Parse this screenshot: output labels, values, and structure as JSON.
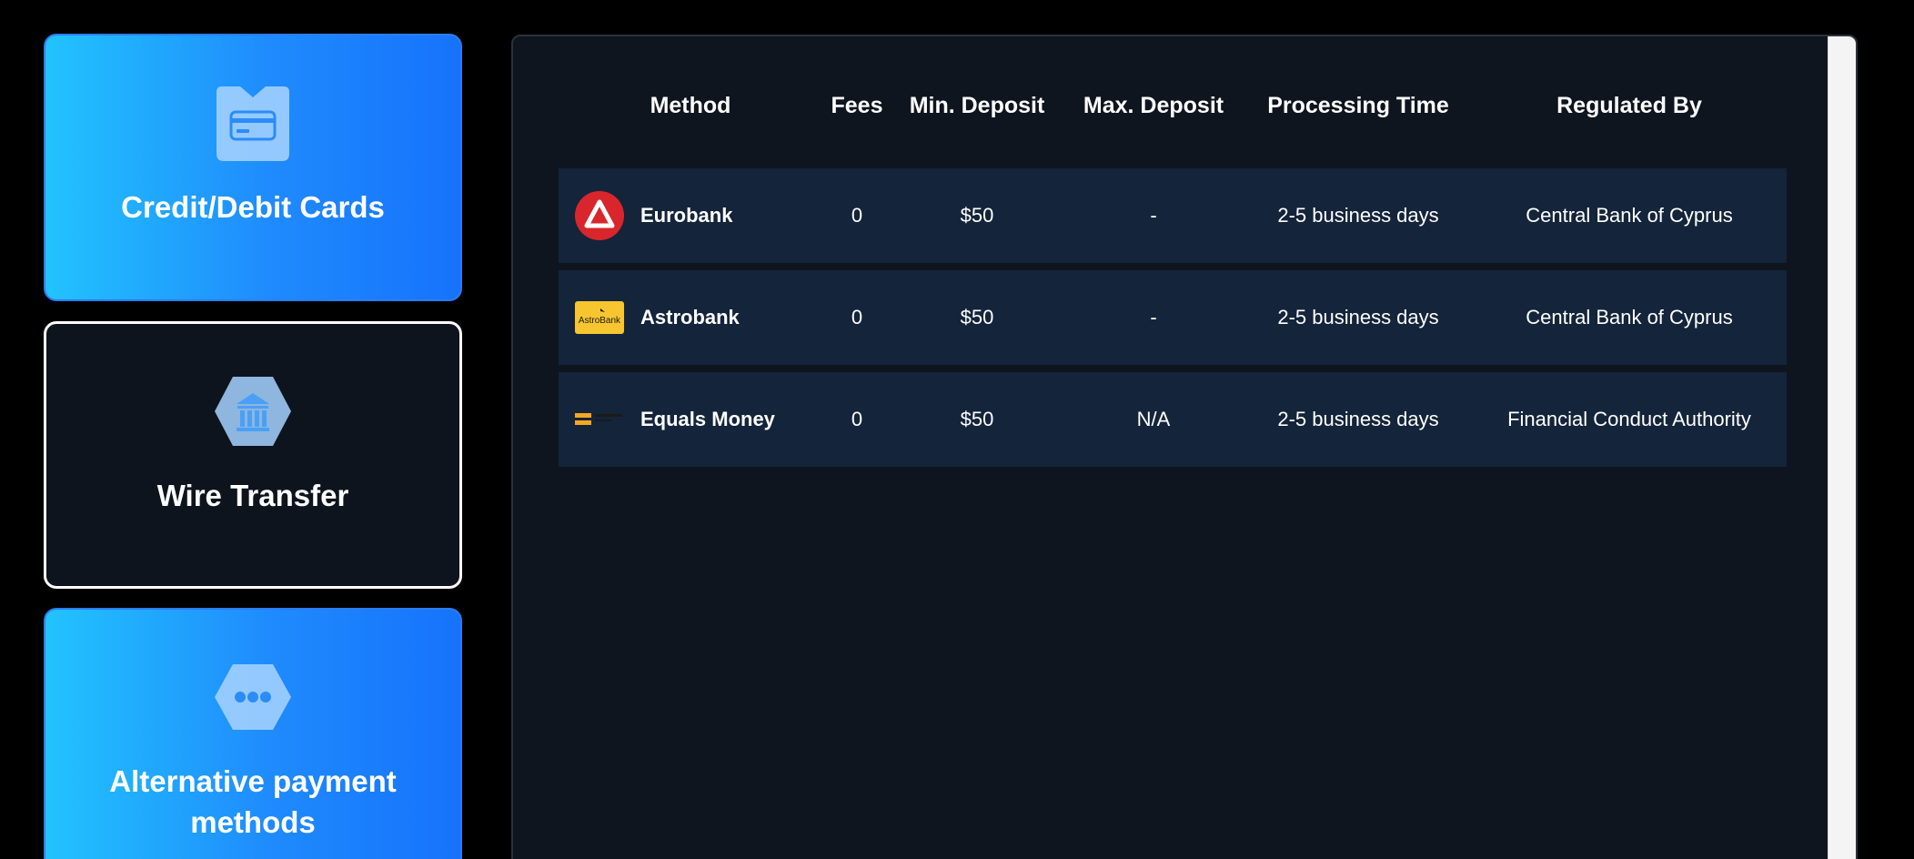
{
  "categories": [
    {
      "label": "Credit/Debit Cards",
      "icon": "credit-card-icon",
      "active": true
    },
    {
      "label": "Wire Transfer",
      "icon": "bank-icon",
      "active": false
    },
    {
      "label": "Alternative payment methods",
      "icon": "more-dots-icon",
      "active": true
    }
  ],
  "table": {
    "headers": {
      "method": "Method",
      "fees": "Fees",
      "min_deposit": "Min. Deposit",
      "max_deposit": "Max. Deposit",
      "processing_time": "Processing Time",
      "regulated_by": "Regulated By"
    },
    "rows": [
      {
        "name": "Eurobank",
        "logo": "eurobank-logo",
        "fees": "0",
        "min_deposit": "$50",
        "max_deposit": "-",
        "processing_time": "2-5 business days",
        "regulated_by": "Central Bank of Cyprus"
      },
      {
        "name": "Astrobank",
        "logo": "astrobank-logo",
        "logo_text": "AstroBank",
        "fees": "0",
        "min_deposit": "$50",
        "max_deposit": "-",
        "processing_time": "2-5 business days",
        "regulated_by": "Central Bank of Cyprus"
      },
      {
        "name": "Equals Money",
        "logo": "equals-money-logo",
        "fees": "0",
        "min_deposit": "$50",
        "max_deposit": "N/A",
        "processing_time": "2-5 business days",
        "regulated_by": "Financial Conduct Authority"
      }
    ]
  },
  "colors": {
    "accent_gradient_start": "#22c3fd",
    "accent_gradient_end": "#1673fb",
    "panel_background": "#0e151f",
    "row_background": "#14243a",
    "eurobank_red": "#d9262c",
    "astrobank_yellow": "#f7c52f",
    "equals_orange": "#f5a623"
  }
}
